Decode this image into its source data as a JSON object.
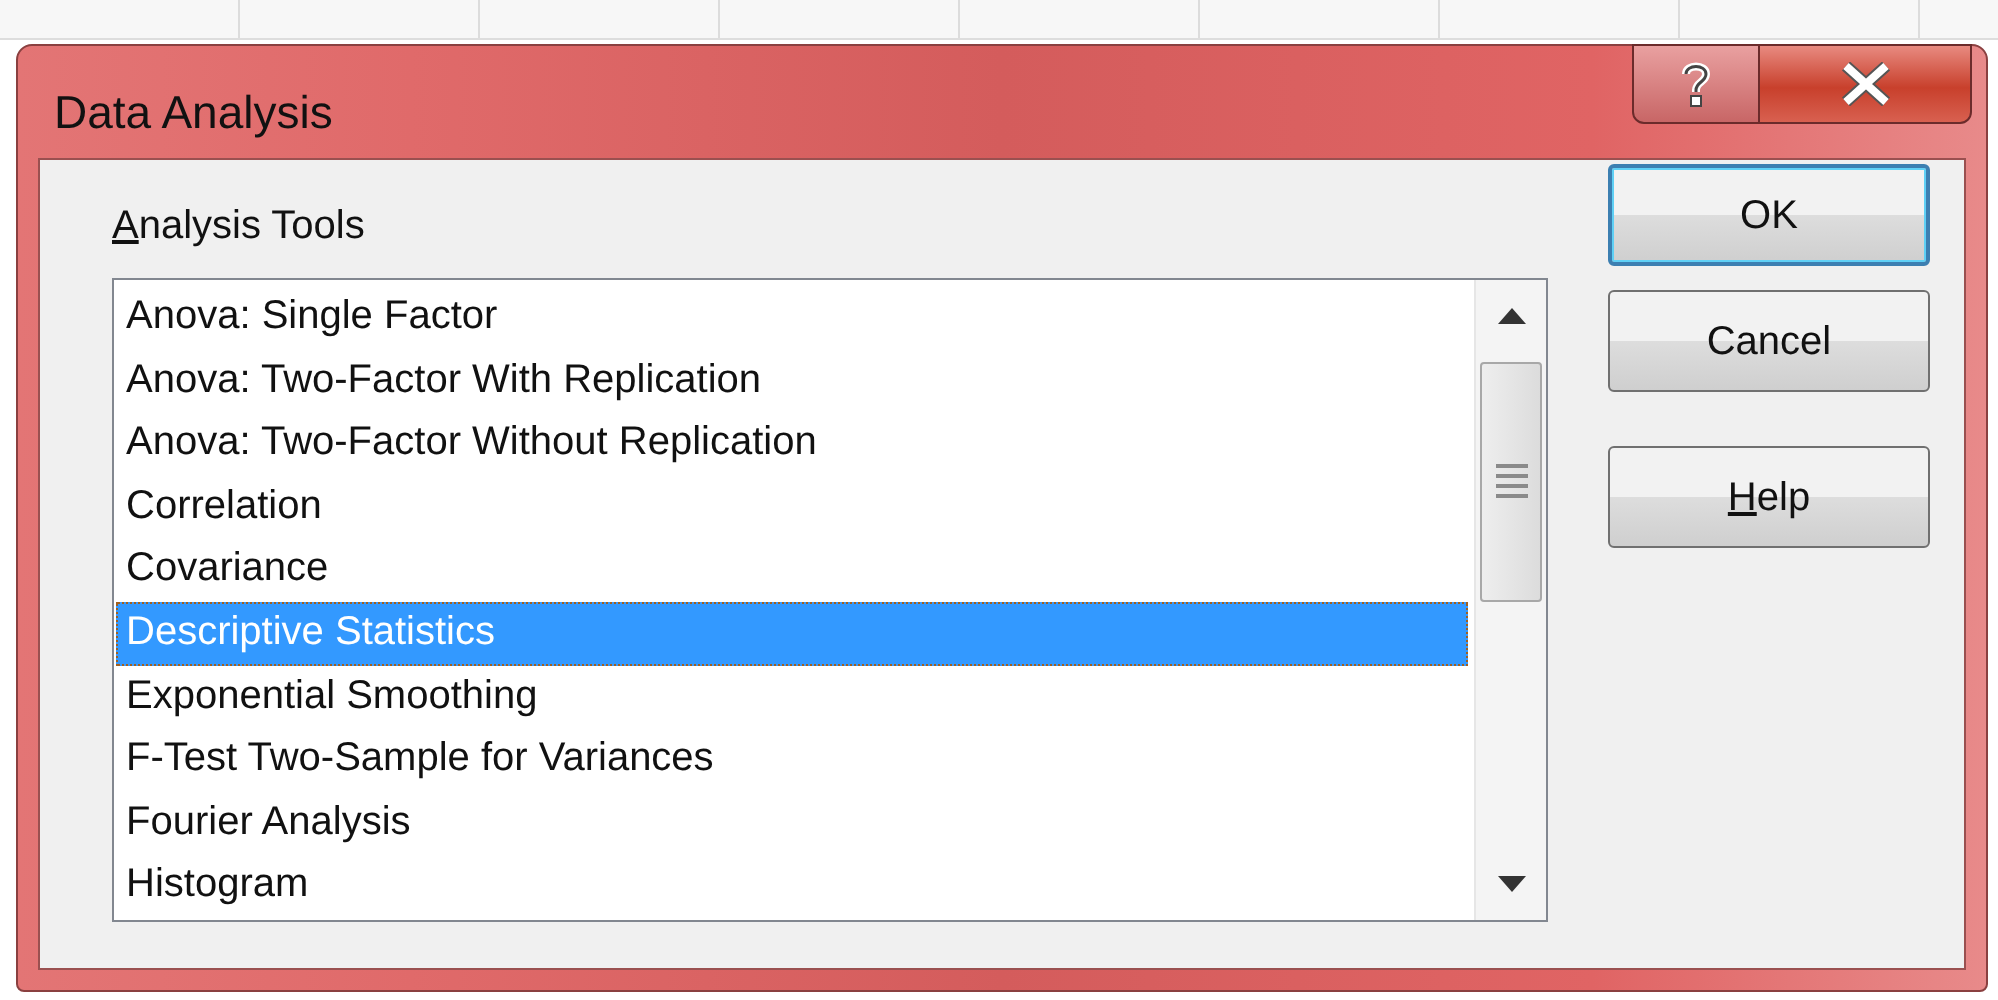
{
  "window": {
    "title": "Data Analysis"
  },
  "group": {
    "mnemonic": "A",
    "label_rest": "nalysis Tools"
  },
  "tools": [
    {
      "label": "Anova: Single Factor",
      "selected": false
    },
    {
      "label": "Anova: Two-Factor With Replication",
      "selected": false
    },
    {
      "label": "Anova: Two-Factor Without Replication",
      "selected": false
    },
    {
      "label": "Correlation",
      "selected": false
    },
    {
      "label": "Covariance",
      "selected": false
    },
    {
      "label": "Descriptive Statistics",
      "selected": true
    },
    {
      "label": "Exponential Smoothing",
      "selected": false
    },
    {
      "label": "F-Test Two-Sample for Variances",
      "selected": false
    },
    {
      "label": "Fourier Analysis",
      "selected": false
    },
    {
      "label": "Histogram",
      "selected": false
    }
  ],
  "buttons": [
    {
      "label_rest": "OK",
      "default": true
    },
    {
      "label_rest": "Cancel",
      "default": false
    },
    {
      "mnemonic": "H",
      "label_rest": "elp",
      "default": false
    }
  ]
}
